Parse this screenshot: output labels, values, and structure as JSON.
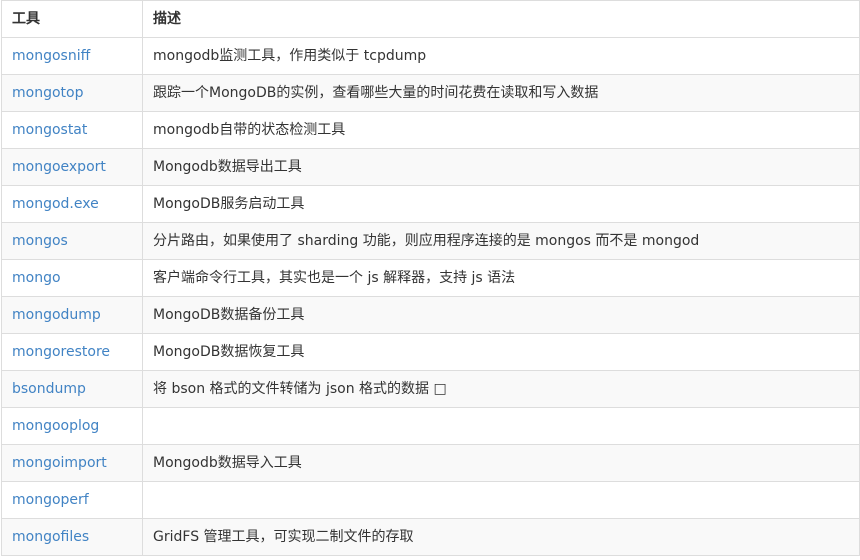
{
  "header": {
    "tool": "工具",
    "description": "描述"
  },
  "rows": [
    {
      "tool": "mongosniff",
      "description": "mongodb监测工具，作用类似于 tcpdump"
    },
    {
      "tool": "mongotop",
      "description": "跟踪一个MongoDB的实例，查看哪些大量的时间花费在读取和写入数据"
    },
    {
      "tool": "mongostat",
      "description": "mongodb自带的状态检测工具"
    },
    {
      "tool": "mongoexport",
      "description": "Mongodb数据导出工具"
    },
    {
      "tool": "mongod.exe",
      "description": "MongoDB服务启动工具"
    },
    {
      "tool": "mongos",
      "description": "分片路由，如果使用了 sharding 功能，则应用程序连接的是 mongos 而不是 mongod"
    },
    {
      "tool": "mongo",
      "description": "客户端命令行工具，其实也是一个 js 解释器，支持 js 语法"
    },
    {
      "tool": "mongodump",
      "description": "MongoDB数据备份工具"
    },
    {
      "tool": "mongorestore",
      "description": "MongoDB数据恢复工具"
    },
    {
      "tool": "bsondump",
      "description": "将 bson 格式的文件转储为 json 格式的数据 □"
    },
    {
      "tool": "mongooplog",
      "description": ""
    },
    {
      "tool": "mongoimport",
      "description": "Mongodb数据导入工具"
    },
    {
      "tool": "mongoperf",
      "description": ""
    },
    {
      "tool": "mongofiles",
      "description": "GridFS 管理工具，可实现二制文件的存取"
    }
  ]
}
